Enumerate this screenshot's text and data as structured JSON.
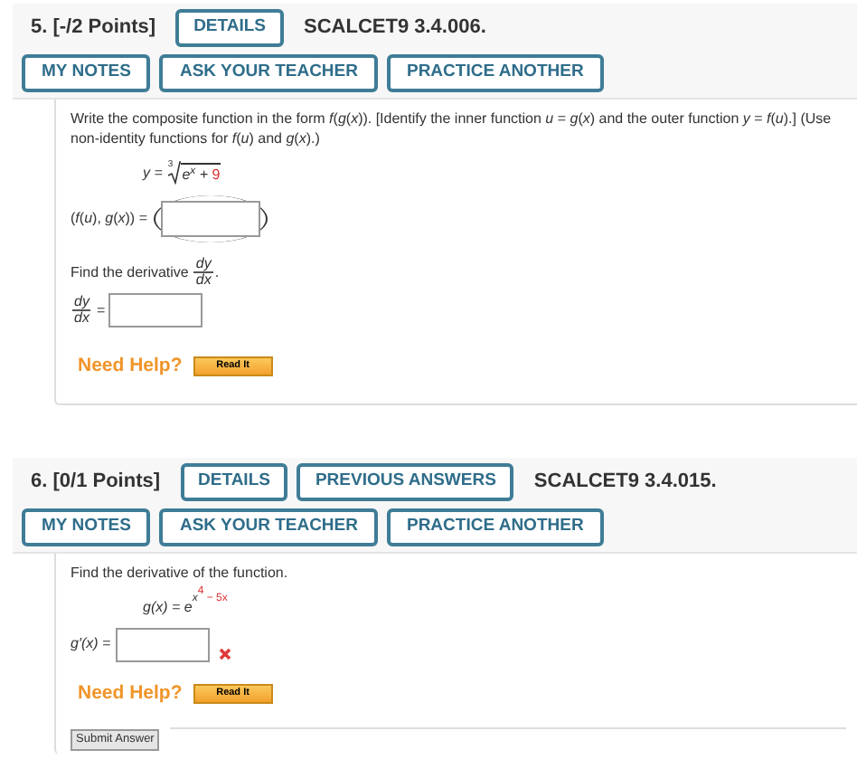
{
  "questions": [
    {
      "number": "5.",
      "points": "[-/2 Points]",
      "header_buttons": [
        "DETAILS"
      ],
      "code": "SCALCET9 3.4.006.",
      "action_buttons": [
        "MY NOTES",
        "ASK YOUR TEACHER",
        "PRACTICE ANOTHER"
      ],
      "body": [
        {
          "kind": "text",
          "text": "Write the composite function in the form *f*(*g*(*x*)). [Identify the inner function *u* = *g*(*x*) and the outer function *y* = *f*(*u*).] (Use non-identity functions for *f*(*u*) and *g*(*x*).)"
        },
        {
          "kind": "root_formula",
          "lhs": "y =",
          "index": "3",
          "radicand": [
            {
              "text": "e$^{x}$ + ",
              "kind": "var"
            },
            {
              "text": "9",
              "kind": "number"
            }
          ]
        },
        {
          "kind": "paren_answer",
          "label": "(*f*(*u*), *g*(*x*)) ="
        },
        {
          "kind": "text_fraction",
          "text": "Find the derivative",
          "numerator": "dy",
          "denominator": "dx",
          "trail": "."
        },
        {
          "kind": "fraction_answer",
          "numerator": "dy",
          "denominator": "dx",
          "equals": "="
        }
      ],
      "need_help": "Need Help?",
      "read_it": "Read It"
    },
    {
      "number": "6.",
      "points": "[0/1 Points]",
      "header_buttons": [
        "DETAILS",
        "PREVIOUS ANSWERS"
      ],
      "code": "SCALCET9 3.4.015.",
      "action_buttons": [
        "MY NOTES",
        "ASK YOUR TEACHER",
        "PRACTICE ANOTHER"
      ],
      "body": [
        {
          "kind": "text",
          "text": "Find the derivative of the function."
        },
        {
          "kind": "exp_formula",
          "base": "g(x) = e",
          "exponent": [
            {
              "text": "x",
              "kind": "var"
            },
            {
              "text": "4",
              "kind": "number_raised"
            },
            {
              "text": " − 5x",
              "kind": "number"
            }
          ]
        },
        {
          "kind": "answer",
          "label": "g′(x) =",
          "incorrect": true
        }
      ],
      "need_help": "Need Help?",
      "read_it": "Read It",
      "submit": "Submit Answer"
    }
  ]
}
